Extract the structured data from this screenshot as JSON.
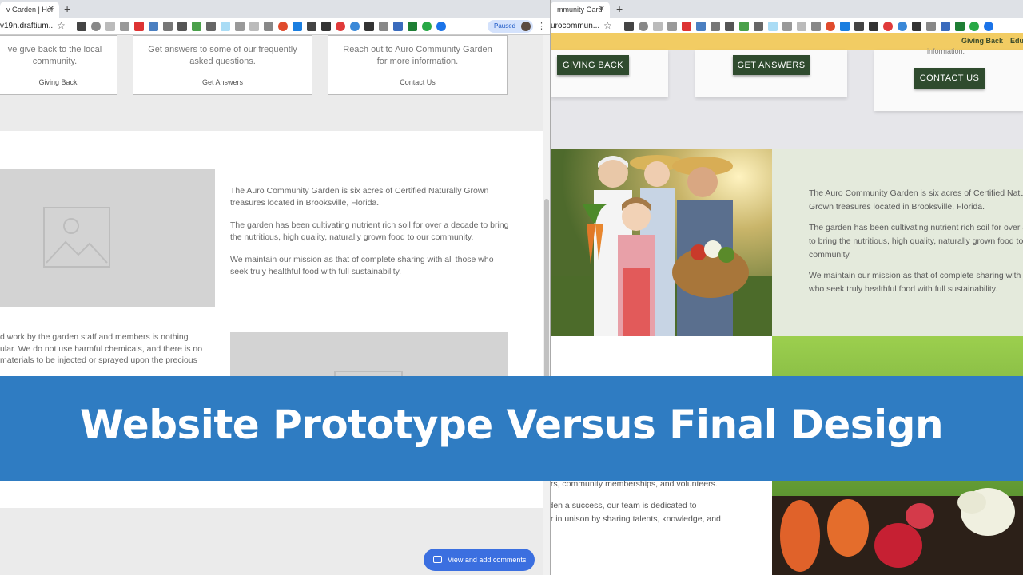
{
  "left_browser": {
    "tab_title": "v Garden | Hor",
    "url": "v19n.draftium...",
    "paused_label": "Paused"
  },
  "right_browser": {
    "tab_title": "mmunity Gard",
    "url": "urocommun..."
  },
  "prototype": {
    "cards": [
      {
        "text": "ve give back to the local community.",
        "link": "Giving Back"
      },
      {
        "text": "Get answers to some of our frequently asked questions.",
        "link": "Get Answers"
      },
      {
        "text": "Reach out to Auro Community Garden for more information.",
        "link": "Contact Us"
      }
    ],
    "about_paragraphs": [
      "The Auro Community Garden is six acres of Certified Naturally Grown treasures located in Brooksville, Florida.",
      "The garden has been cultivating nutrient rich soil for over a decade to bring the nutritious, high quality, naturally grown food to our community.",
      "We maintain our mission as that of complete sharing with all those who seek truly healthful food with full sustainability."
    ],
    "lower_lines": [
      "d work by the garden staff and members is nothing",
      "ular. We do not use harmful chemicals, and there is no",
      "materials to be injected or sprayed upon the precious"
    ],
    "comments_button": "View and add comments"
  },
  "final": {
    "nav": [
      "Giving Back",
      "Edu"
    ],
    "card_fragment": "information.",
    "buttons": [
      "GIVING BACK",
      "GET ANSWERS",
      "CONTACT US"
    ],
    "about_paragraphs": [
      "The Auro Community Garden is six acres of Certified Naturally Grown treasures located in Brooksville, Florida.",
      "The garden has been cultivating nutrient rich soil for over a decade to bring the nutritious, high quality, naturally grown food to our community.",
      "We maintain our mission as that of complete sharing with all those who seek truly healthful food with full sustainability."
    ],
    "lower_lines": [
      "ers, community memberships, and volunteers.",
      "rden a success, our team is dedicated to",
      "er in unison by sharing talents, knowledge, and"
    ]
  },
  "banner": {
    "title": "Website Prototype Versus Final Design"
  },
  "colors": {
    "banner": "#2f7cc2",
    "nav_yellow": "#f2cc63",
    "button_green": "#2f4b2e",
    "sage": "#e4eadc"
  }
}
